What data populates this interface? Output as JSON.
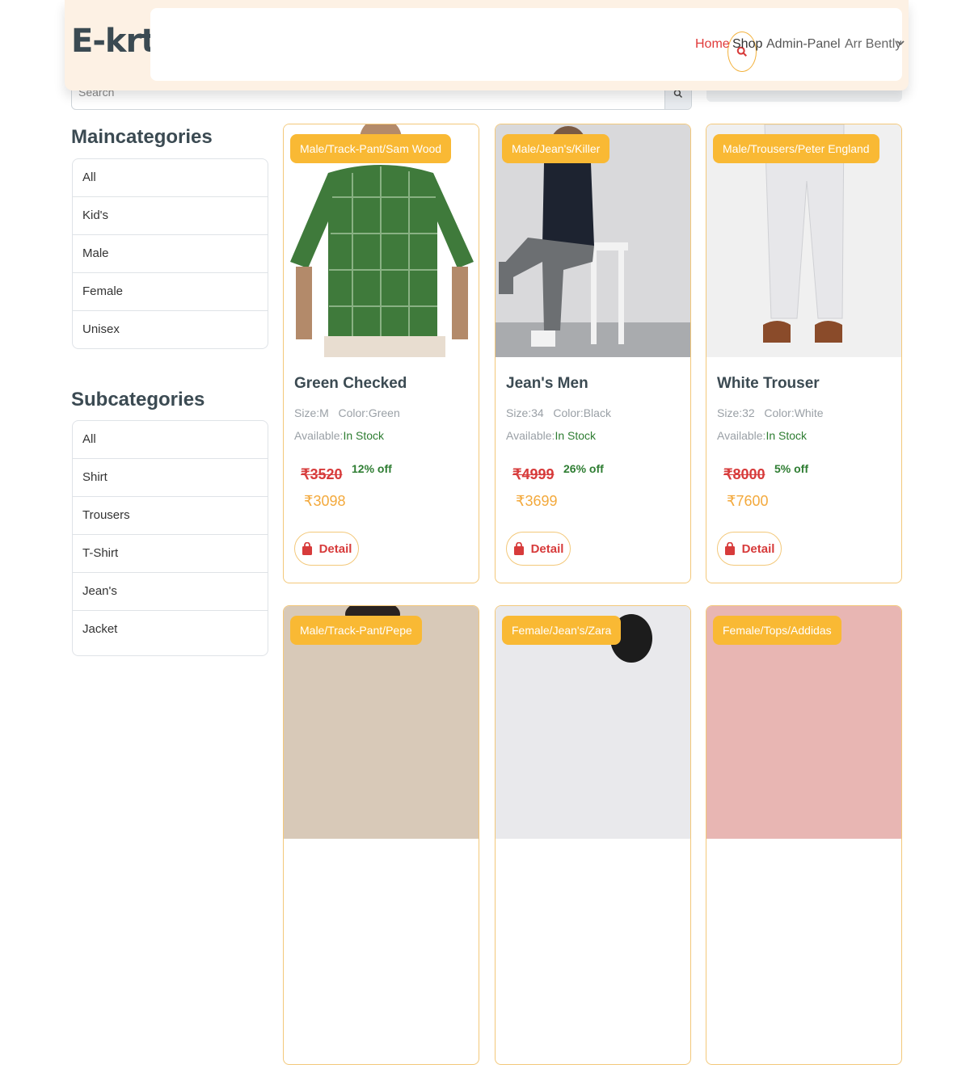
{
  "brand": "E-krt",
  "nav": {
    "home": "Home",
    "shop": "Shop",
    "admin": "Admin-Panel",
    "user": "Arr Bently"
  },
  "search": {
    "placeholder": "Search"
  },
  "sidebar": {
    "main_title": "Maincategories",
    "main_items": [
      "All",
      "Kid's",
      "Male",
      "Female",
      "Unisex"
    ],
    "sub_title": "Subcategories",
    "sub_items": [
      "All",
      "Shirt",
      "Trousers",
      "T-Shirt",
      "Jean's",
      "Jacket"
    ]
  },
  "products": [
    {
      "badge": "Male/Track-Pant/Sam Wood",
      "name": "Green Checked",
      "size_label": "Size:M",
      "color_label": "Color:Green",
      "avail_label": "Available:",
      "stock": "In Stock",
      "old_price": "₹3520",
      "discount": "12% off",
      "price": "₹3098",
      "detail": "Detail"
    },
    {
      "badge": "Male/Jean's/Killer",
      "name": "Jean's Men",
      "size_label": "Size:34",
      "color_label": "Color:Black",
      "avail_label": "Available:",
      "stock": "In Stock",
      "old_price": "₹4999",
      "discount": "26% off",
      "price": "₹3699",
      "detail": "Detail"
    },
    {
      "badge": "Male/Trousers/Peter England",
      "name": "White Trouser",
      "size_label": "Size:32",
      "color_label": "Color:White",
      "avail_label": "Available:",
      "stock": "In Stock",
      "old_price": "₹8000",
      "discount": "5% off",
      "price": "₹7600",
      "detail": "Detail"
    },
    {
      "badge": "Male/Track-Pant/Pepe"
    },
    {
      "badge": "Female/Jean's/Zara"
    },
    {
      "badge": "Female/Tops/Addidas"
    }
  ],
  "colors": {
    "accent": "#f9b934",
    "brand": "#3b4a52",
    "danger": "#d73b3b",
    "success": "#2e7d32",
    "header_bg": "#fdf1e4"
  }
}
